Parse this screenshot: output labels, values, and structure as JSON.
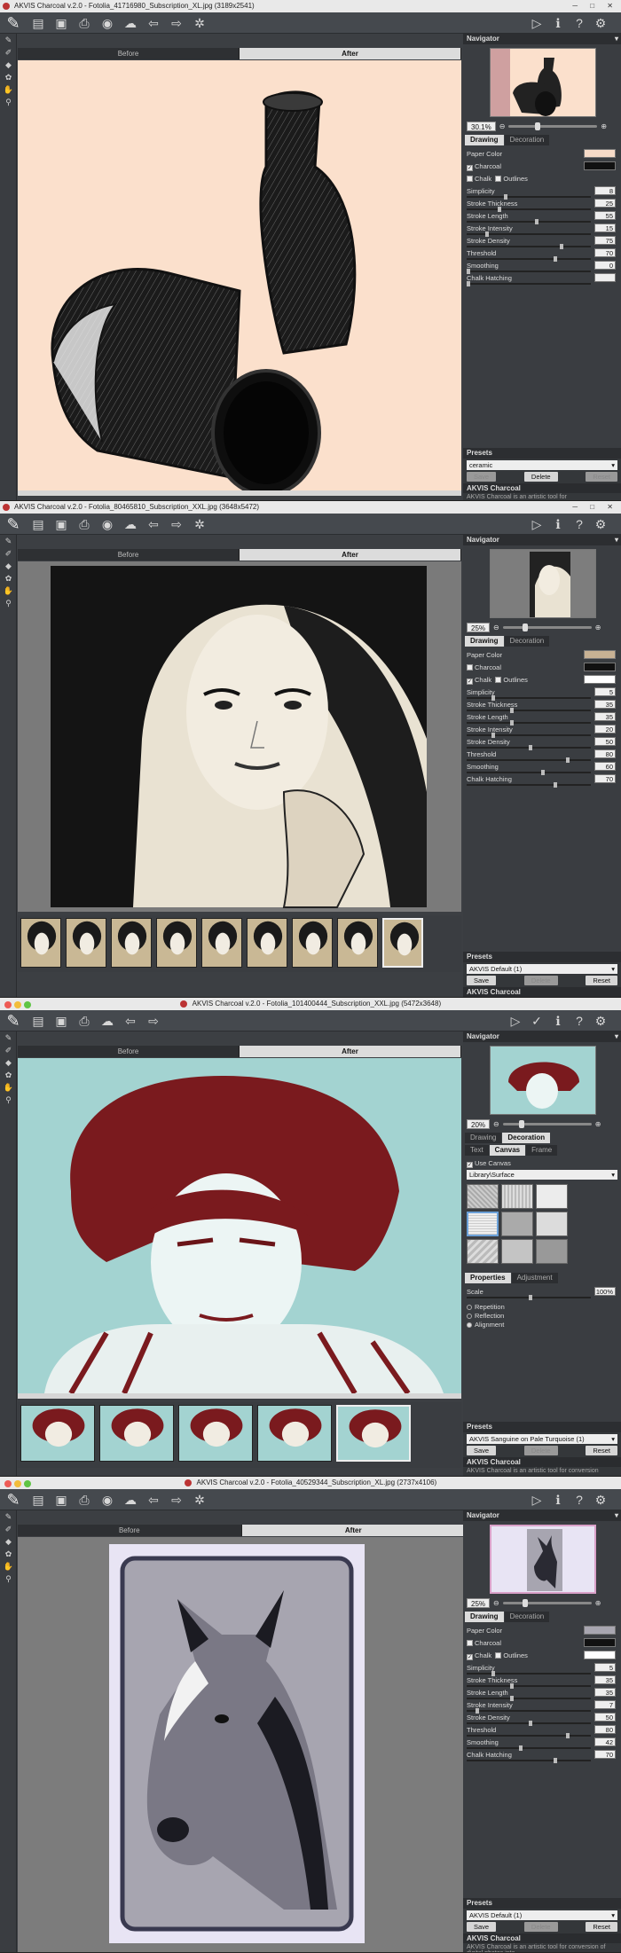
{
  "colors": {
    "titlebar": "#e9e9e9",
    "toolbar": "#45494e",
    "panel": "#3a3d41",
    "accent_pink": "#d9a0c8",
    "teal": "#9ed0cf",
    "crimson": "#7a1a1e"
  },
  "windows": [
    {
      "title": "AKVIS Charcoal v.2.0 - Fotolia_41716980_Subscription_XL.jpg (3189x2541)",
      "tabs": {
        "before": "Before",
        "after": "After"
      },
      "navigator_label": "Navigator",
      "zoom": "30.1%",
      "panel_tabs": [
        "Drawing",
        "Decoration"
      ],
      "active_panel_tab": "Drawing",
      "paper_color_label": "Paper Color",
      "paper_color": "#f6dbc8",
      "charcoal_label": "Charcoal",
      "charcoal_checked": true,
      "chalk_label": "Chalk",
      "chalk_checked": false,
      "outlines_label": "Outlines",
      "outlines_checked": false,
      "params": [
        {
          "label": "Simplicity",
          "value": "8",
          "level": 0.3
        },
        {
          "label": "Stroke Thickness",
          "value": "25",
          "level": 0.25
        },
        {
          "label": "Stroke Length",
          "value": "55",
          "level": 0.55
        },
        {
          "label": "Stroke Intensity",
          "value": "15",
          "level": 0.15
        },
        {
          "label": "Stroke Density",
          "value": "75",
          "level": 0.75
        },
        {
          "label": "Threshold",
          "value": "70",
          "level": 0.7
        },
        {
          "label": "Smoothing",
          "value": "0",
          "level": 0.0
        },
        {
          "label": "Chalk Hatching",
          "value": "",
          "level": 0.0
        }
      ],
      "presets_label": "Presets",
      "preset": "ceramic",
      "buttons": {
        "save": "Save",
        "delete": "Delete",
        "reset": "Reset"
      },
      "info_title": "AKVIS Charcoal",
      "info_text": "AKVIS Charcoal is an artistic tool for"
    },
    {
      "title": "AKVIS Charcoal v.2.0 - Fotolia_80465810_Subscription_XXL.jpg (3648x5472)",
      "tabs": {
        "before": "Before",
        "after": "After"
      },
      "navigator_label": "Navigator",
      "zoom": "25%",
      "panel_tabs": [
        "Drawing",
        "Decoration"
      ],
      "active_panel_tab": "Drawing",
      "paper_color_label": "Paper Color",
      "paper_color": "#c8b294",
      "charcoal_label": "Charcoal",
      "charcoal_checked": false,
      "chalk_label": "Chalk",
      "chalk_checked": true,
      "outlines_label": "Outlines",
      "outlines_checked": false,
      "params": [
        {
          "label": "Simplicity",
          "value": "5",
          "level": 0.2
        },
        {
          "label": "Stroke Thickness",
          "value": "35",
          "level": 0.35
        },
        {
          "label": "Stroke Length",
          "value": "35",
          "level": 0.35
        },
        {
          "label": "Stroke Intensity",
          "value": "20",
          "level": 0.2
        },
        {
          "label": "Stroke Density",
          "value": "50",
          "level": 0.5
        },
        {
          "label": "Threshold",
          "value": "80",
          "level": 0.8
        },
        {
          "label": "Smoothing",
          "value": "60",
          "level": 0.6
        },
        {
          "label": "Chalk Hatching",
          "value": "70",
          "level": 0.7
        }
      ],
      "presets_label": "Presets",
      "preset": "AKVIS Default (1)",
      "buttons": {
        "save": "Save",
        "delete": "Delete",
        "reset": "Reset"
      },
      "info_title": "AKVIS Charcoal",
      "strip_count": 9
    },
    {
      "title": "AKVIS Charcoal v.2.0 - Fotolia_101400444_Subscription_XXL.jpg (5472x3648)",
      "tabs": {
        "before": "Before",
        "after": "After"
      },
      "navigator_label": "Navigator",
      "zoom": "20%",
      "panel_tabs": [
        "Drawing",
        "Decoration"
      ],
      "active_panel_tab": "Decoration",
      "sub_tabs": [
        "Text",
        "Canvas",
        "Frame"
      ],
      "active_sub_tab": "Canvas",
      "use_canvas_label": "Use Canvas",
      "library": "Library\\Surface",
      "prop_tabs": [
        "Properties",
        "Adjustment"
      ],
      "scale_label": "Scale",
      "scale_value": "100%",
      "radio_options": [
        "Repetition",
        "Reflection",
        "Alignment"
      ],
      "radio_selected": "Alignment",
      "presets_label": "Presets",
      "preset": "AKVIS Sanguine on Pale Turquoise (1)",
      "buttons": {
        "save": "Save",
        "delete": "Delete",
        "reset": "Reset"
      },
      "info_title": "AKVIS Charcoal",
      "info_text": "AKVIS Charcoal is an artistic tool for conversion",
      "strip_count": 5
    },
    {
      "title": "AKVIS Charcoal v.2.0 - Fotolia_40529344_Subscription_XL.jpg (2737x4106)",
      "tabs": {
        "before": "Before",
        "after": "After"
      },
      "navigator_label": "Navigator",
      "zoom": "25%",
      "panel_tabs": [
        "Drawing",
        "Decoration"
      ],
      "active_panel_tab": "Drawing",
      "paper_color_label": "Paper Color",
      "paper_color": "#a8a6b0",
      "charcoal_label": "Charcoal",
      "charcoal_checked": false,
      "chalk_label": "Chalk",
      "chalk_checked": true,
      "outlines_label": "Outlines",
      "outlines_checked": false,
      "params": [
        {
          "label": "Simplicity",
          "value": "5",
          "level": 0.2
        },
        {
          "label": "Stroke Thickness",
          "value": "35",
          "level": 0.35
        },
        {
          "label": "Stroke Length",
          "value": "35",
          "level": 0.35
        },
        {
          "label": "Stroke Intensity",
          "value": "7",
          "level": 0.07
        },
        {
          "label": "Stroke Density",
          "value": "50",
          "level": 0.5
        },
        {
          "label": "Threshold",
          "value": "80",
          "level": 0.8
        },
        {
          "label": "Smoothing",
          "value": "42",
          "level": 0.42
        },
        {
          "label": "Chalk Hatching",
          "value": "70",
          "level": 0.7
        }
      ],
      "presets_label": "Presets",
      "preset": "AKVIS Default (1)",
      "buttons": {
        "save": "Save",
        "delete": "Delete",
        "reset": "Reset"
      },
      "info_title": "AKVIS Charcoal",
      "info_text": "AKVIS Charcoal is an artistic tool for conversion of digital photos into"
    }
  ]
}
